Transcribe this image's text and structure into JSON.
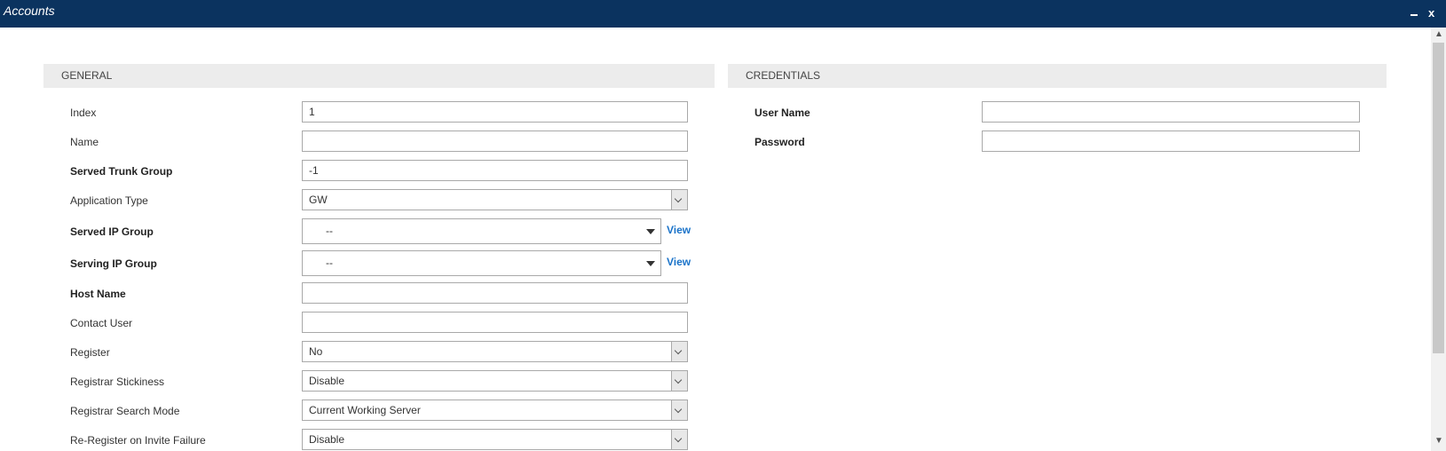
{
  "window": {
    "title": "Accounts",
    "minimize_label": "–",
    "close_label": "x"
  },
  "scrollbar": {
    "up": "▲",
    "down": "▼"
  },
  "general": {
    "heading": "GENERAL",
    "fields": {
      "index": {
        "label": "Index",
        "value": "1"
      },
      "name": {
        "label": "Name",
        "value": ""
      },
      "served_trunk_group": {
        "label": "Served Trunk Group",
        "value": "-1"
      },
      "application_type": {
        "label": "Application Type",
        "value": "GW"
      },
      "served_ip_group": {
        "label": "Served IP Group",
        "value": "--",
        "link": "View"
      },
      "serving_ip_group": {
        "label": "Serving IP Group",
        "value": "--",
        "link": "View"
      },
      "host_name": {
        "label": "Host Name",
        "value": ""
      },
      "contact_user": {
        "label": "Contact User",
        "value": ""
      },
      "register": {
        "label": "Register",
        "value": "No"
      },
      "registrar_stickiness": {
        "label": "Registrar Stickiness",
        "value": "Disable"
      },
      "registrar_search_mode": {
        "label": "Registrar Search Mode",
        "value": "Current Working Server"
      },
      "reregister_on_invite_failure": {
        "label": "Re-Register on Invite Failure",
        "value": "Disable"
      }
    }
  },
  "credentials": {
    "heading": "CREDENTIALS",
    "fields": {
      "user_name": {
        "label": "User Name",
        "value": ""
      },
      "password": {
        "label": "Password",
        "value": ""
      }
    }
  }
}
